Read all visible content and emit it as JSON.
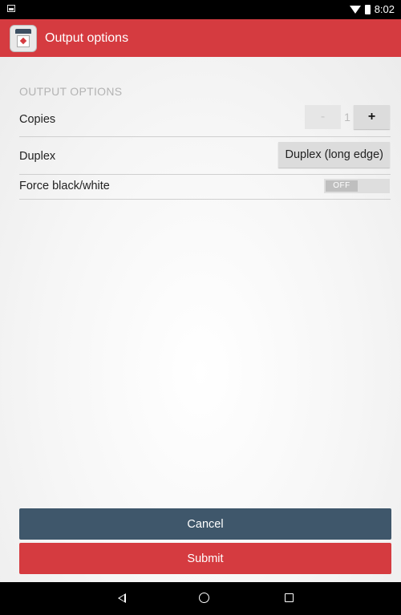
{
  "status_bar": {
    "time": "8:02"
  },
  "app_bar": {
    "title": "Output options"
  },
  "section": {
    "header": "OUTPUT OPTIONS"
  },
  "copies": {
    "label": "Copies",
    "minus_label": "-",
    "value": "1",
    "plus_label": "+"
  },
  "duplex": {
    "label": "Duplex",
    "value": "Duplex (long edge)"
  },
  "force_bw": {
    "label": "Force black/white",
    "toggle_state": "OFF"
  },
  "actions": {
    "cancel_label": "Cancel",
    "submit_label": "Submit"
  },
  "colors": {
    "accent": "#d53b40",
    "secondary": "#3f576b"
  },
  "icons": {
    "app": "printer-icon",
    "nav_back": "back-icon",
    "nav_home": "home-icon",
    "nav_recents": "recents-icon"
  }
}
